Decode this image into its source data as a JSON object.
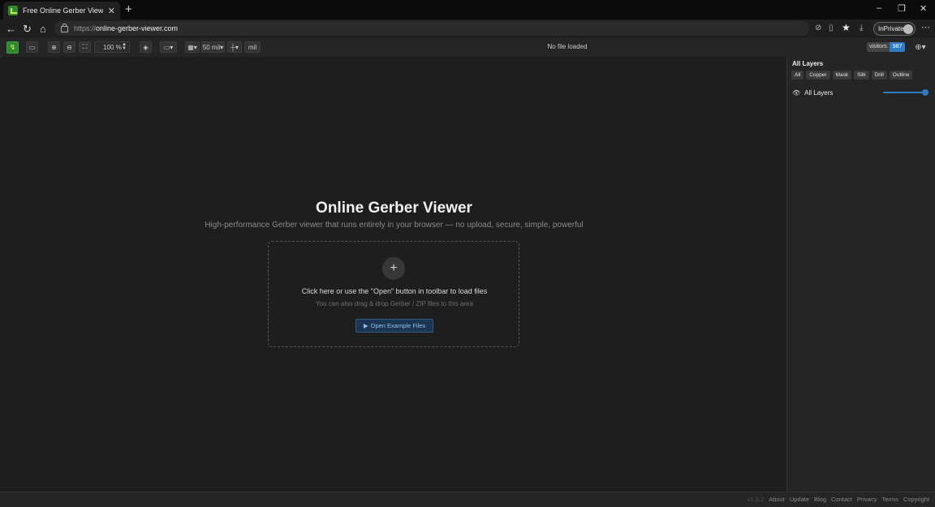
{
  "browser": {
    "tab_title": "Free Online Gerber Viewer - View G",
    "url_protocol": "https://",
    "url_host": "online-gerber-viewer.com",
    "inprivate_label": "InPrivate"
  },
  "toolbar": {
    "zoom_value": "100 %",
    "grid_size": "50 mil",
    "unit": "mil",
    "status": "No file loaded",
    "visitors_label": "visitors",
    "visitors_count": "987"
  },
  "main": {
    "title": "Online Gerber Viewer",
    "subtitle": "High-performance Gerber viewer that runs entirely in your browser — no upload, secure, simple, powerful",
    "drop_main": "Click here or use the \"Open\" button in toolbar to load files",
    "drop_sub": "You can also drag & drop Gerber / ZIP files to this area",
    "example_button": "Open Example Files"
  },
  "layers": {
    "title": "All Layers",
    "filters": [
      "All",
      "Copper",
      "Mask",
      "Silk",
      "Drill",
      "Outline"
    ],
    "row_label": "All Layers",
    "opacity_percent": 100
  },
  "footer": {
    "version": "v1.3.2",
    "links": [
      "About",
      "Update",
      "Blog",
      "Contact",
      "Privacy",
      "Terms",
      "Copyright"
    ]
  },
  "colors": {
    "accent": "#2e7bc4",
    "logo": "#2f8a2f",
    "background": "#1e1e1e"
  }
}
